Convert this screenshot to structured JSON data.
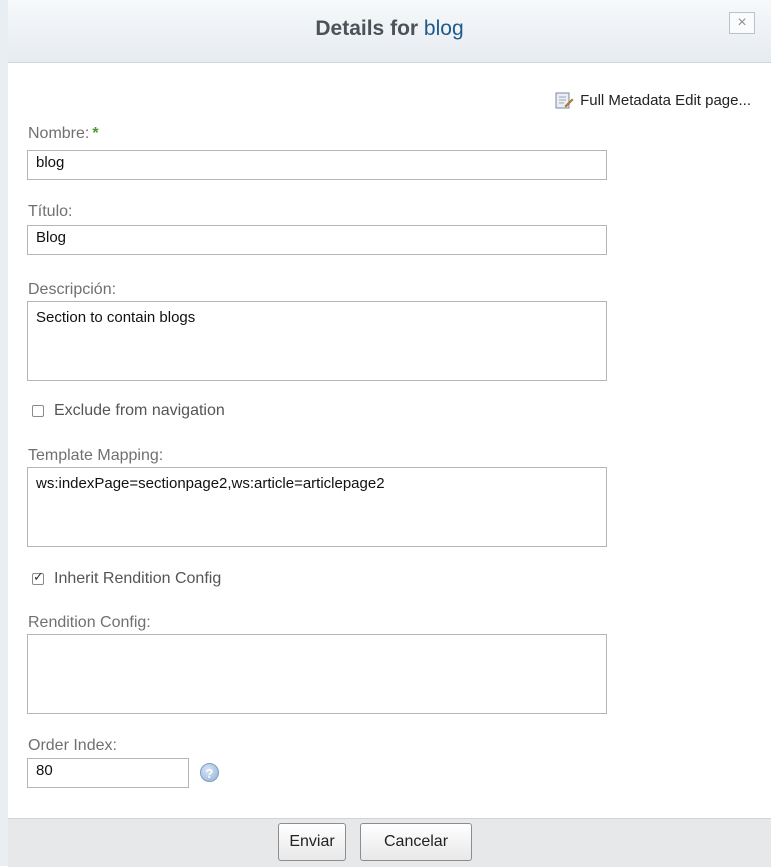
{
  "dialog": {
    "title_prefix": "Details for",
    "title_name": "blog",
    "close_label": "×"
  },
  "metadata_link": "Full Metadata Edit page...",
  "fields": {
    "name": {
      "label": "Nombre:",
      "required_mark": "*",
      "value": "blog"
    },
    "title": {
      "label": "Título:",
      "value": "Blog"
    },
    "description": {
      "label": "Descripción:",
      "value": "Section to contain blogs"
    },
    "exclude_nav": {
      "label": "Exclude from navigation",
      "checked": false
    },
    "template_mapping": {
      "label": "Template Mapping:",
      "value": "ws:indexPage=sectionpage2,ws:article=articlepage2"
    },
    "inherit_rendition": {
      "label": "Inherit Rendition Config",
      "checked": true
    },
    "rendition_config": {
      "label": "Rendition Config:",
      "value": ""
    },
    "order_index": {
      "label": "Order Index:",
      "value": "80",
      "help": "?"
    }
  },
  "buttons": {
    "submit": "Enviar",
    "cancel": "Cancelar"
  }
}
